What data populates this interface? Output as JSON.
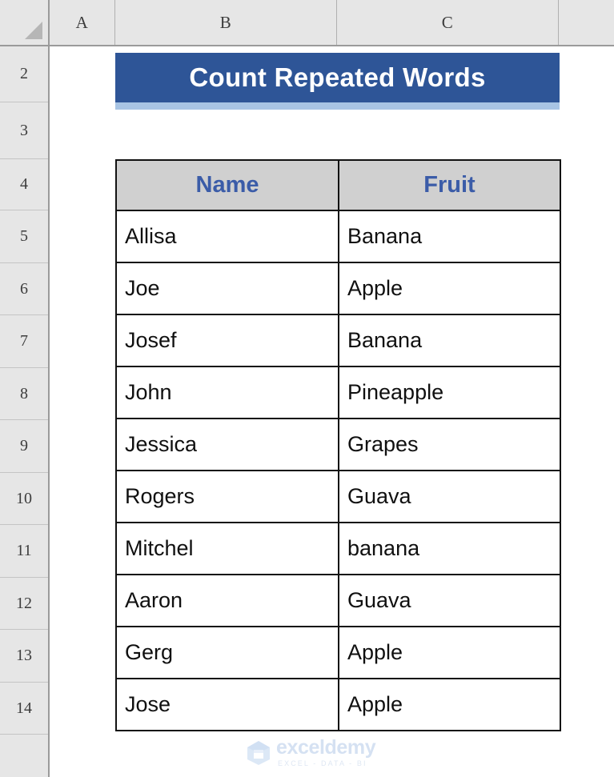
{
  "app": {
    "kind": "spreadsheet",
    "title": "Count Repeated Words"
  },
  "grid": {
    "column_headers": [
      "A",
      "B",
      "C"
    ],
    "row_headers": [
      "2",
      "3",
      "4",
      "5",
      "6",
      "7",
      "8",
      "9",
      "10",
      "11",
      "12",
      "13",
      "14"
    ]
  },
  "title_cell": {
    "text": "Count Repeated Words",
    "background": "#2e5597",
    "text_color": "#ffffff",
    "underline_color": "#a8c4e4"
  },
  "table": {
    "header_background": "#d0d0d0",
    "header_text_color": "#3b5ca8",
    "border_color": "#121212",
    "columns": [
      "Name",
      "Fruit"
    ],
    "rows": [
      {
        "name": "Allisa",
        "fruit": "Banana"
      },
      {
        "name": "Joe",
        "fruit": "Apple"
      },
      {
        "name": "Josef",
        "fruit": "Banana"
      },
      {
        "name": "John",
        "fruit": "Pineapple"
      },
      {
        "name": "Jessica",
        "fruit": "Grapes"
      },
      {
        "name": "Rogers",
        "fruit": "Guava"
      },
      {
        "name": "Mitchel",
        "fruit": "banana"
      },
      {
        "name": "Aaron",
        "fruit": "Guava"
      },
      {
        "name": "Gerg",
        "fruit": "Apple"
      },
      {
        "name": "Jose",
        "fruit": "Apple"
      }
    ]
  },
  "watermark": {
    "name": "exceldemy",
    "tagline": "EXCEL - DATA - BI",
    "color": "#d3e0f2"
  }
}
